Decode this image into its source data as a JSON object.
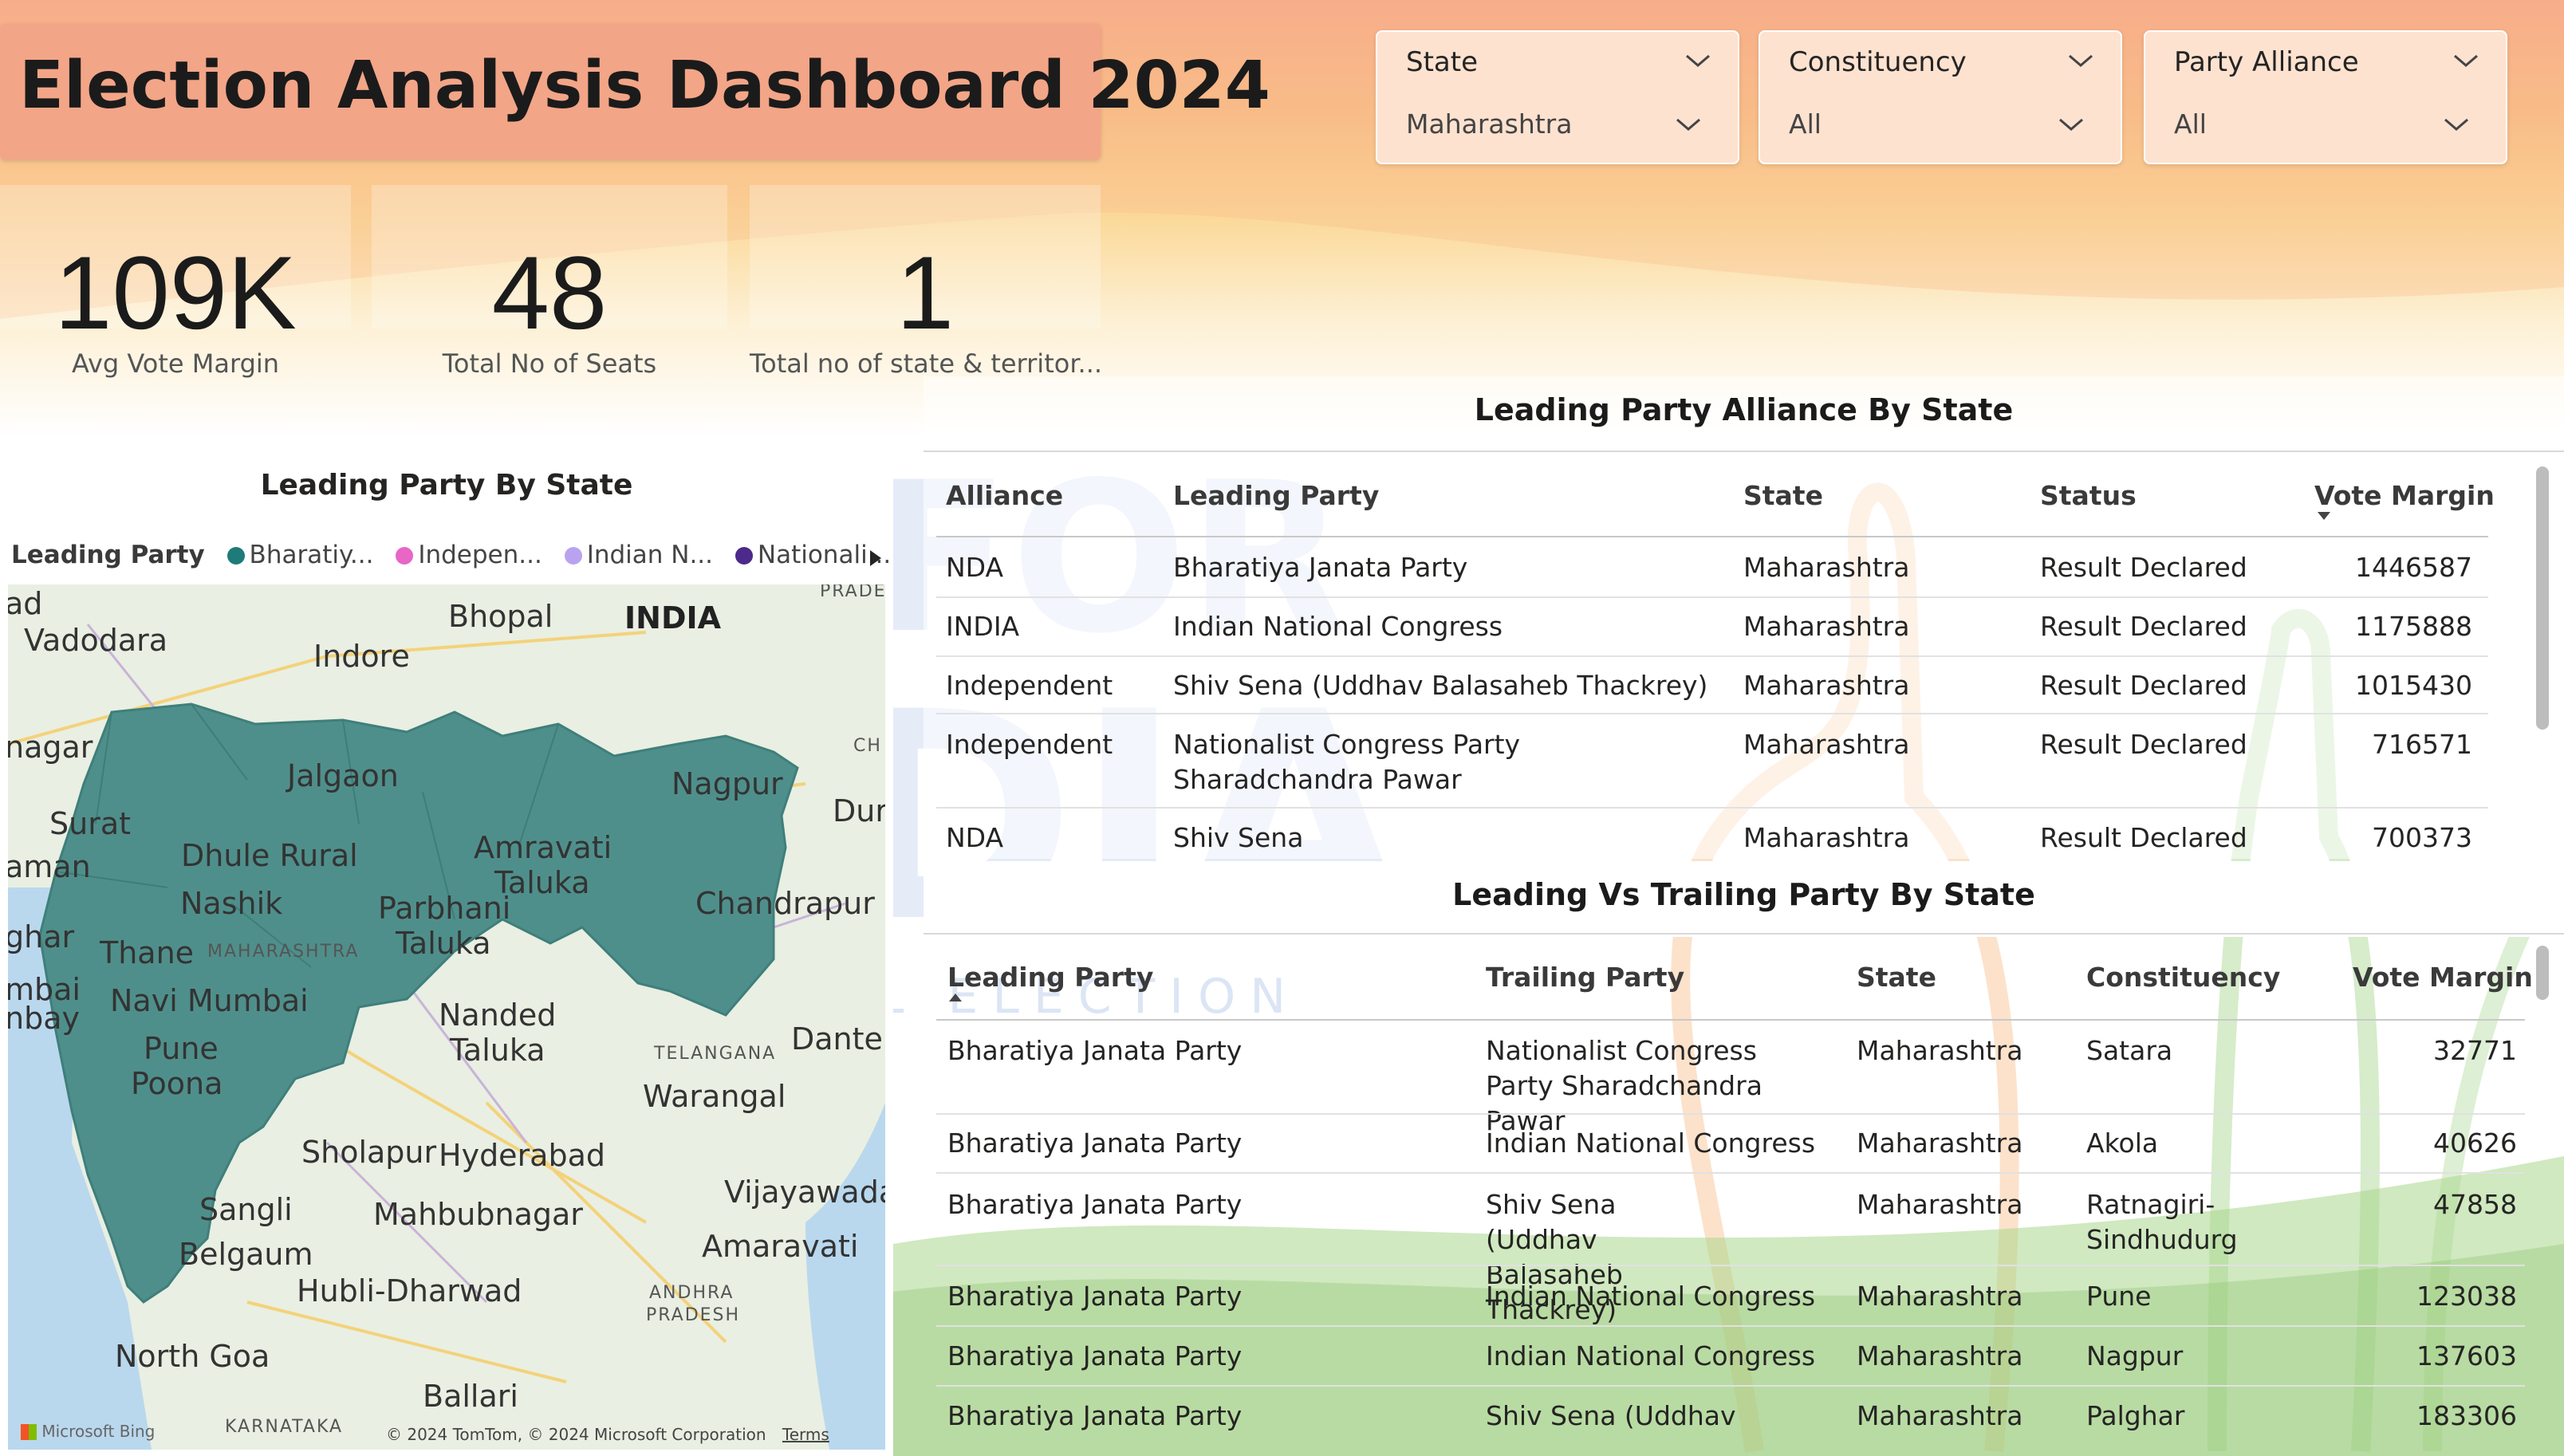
{
  "title": "Election Analysis Dashboard 2024",
  "slicers": [
    {
      "title": "State",
      "value": "Maharashtra"
    },
    {
      "title": "Constituency",
      "value": "All"
    },
    {
      "title": "Party Alliance",
      "value": "All"
    }
  ],
  "kpis": [
    {
      "value": "109K",
      "label": "Avg Vote Margin"
    },
    {
      "value": "48",
      "label": "Total No of Seats"
    },
    {
      "value": "1",
      "label": "Total no of state & territor..."
    }
  ],
  "map": {
    "title": "Leading Party By State",
    "legend_title": "Leading Party",
    "legend_items": [
      {
        "label": "Bharatiy...",
        "color": "#1f7a7a"
      },
      {
        "label": "Indepen...",
        "color": "#e866c5"
      },
      {
        "label": "Indian N...",
        "color": "#b9a3f0"
      },
      {
        "label": "Nationali...",
        "color": "#4b2a8a"
      }
    ],
    "fill_color": "#4f8f8b",
    "cities": [
      {
        "name": "Vadodara"
      },
      {
        "name": "Bhopal"
      },
      {
        "name": "INDIA"
      },
      {
        "name": "Indore"
      },
      {
        "name": "Jalgaon"
      },
      {
        "name": "Nagpur"
      },
      {
        "name": "Surat"
      },
      {
        "name": "Dhule Rural"
      },
      {
        "name": "Amravati"
      },
      {
        "name": "Taluka"
      },
      {
        "name": "Nashik"
      },
      {
        "name": "Parbhani"
      },
      {
        "name": "Taluka"
      },
      {
        "name": "Chandrapur"
      },
      {
        "name": "Thane"
      },
      {
        "name": "MAHARASHTRA"
      },
      {
        "name": "Navi Mumbai"
      },
      {
        "name": "Nanded"
      },
      {
        "name": "Taluka"
      },
      {
        "name": "Pune"
      },
      {
        "name": "Poona"
      },
      {
        "name": "TELANGANA"
      },
      {
        "name": "Warangal"
      },
      {
        "name": "Sholapur"
      },
      {
        "name": "Hyderabad"
      },
      {
        "name": "Vijayawada"
      },
      {
        "name": "Sangli"
      },
      {
        "name": "Mahbubnagar"
      },
      {
        "name": "Belgaum"
      },
      {
        "name": "Amaravati"
      },
      {
        "name": "Hubli-Dharwad"
      },
      {
        "name": "ANDHRA"
      },
      {
        "name": "PRADESH"
      },
      {
        "name": "North Goa"
      },
      {
        "name": "Ballari"
      },
      {
        "name": "KARNATAKA"
      },
      {
        "name": "Dante"
      },
      {
        "name": "Dur"
      },
      {
        "name": "CH"
      },
      {
        "name": "PRADE"
      },
      {
        "name": "nagar"
      },
      {
        "name": "aman"
      },
      {
        "name": "ghar"
      },
      {
        "name": "mbai"
      },
      {
        "name": "nbay"
      },
      {
        "name": "ad"
      }
    ],
    "attribution": "© 2024 TomTom, © 2024 Microsoft Corporation",
    "terms": "Terms",
    "bing": "Microsoft Bing"
  },
  "alliance_table": {
    "title": "Leading Party Alliance By State",
    "columns": [
      "Alliance",
      "Leading Party",
      "State",
      "Status",
      "Vote Margin"
    ],
    "rows": [
      [
        "NDA",
        "Bharatiya Janata Party",
        "Maharashtra",
        "Result Declared",
        "1446587"
      ],
      [
        "INDIA",
        "Indian National Congress",
        "Maharashtra",
        "Result Declared",
        "1175888"
      ],
      [
        "Independent",
        "Shiv Sena (Uddhav Balasaheb Thackrey)",
        "Maharashtra",
        "Result Declared",
        "1015430"
      ],
      [
        "Independent",
        "Nationalist Congress Party Sharadchandra Pawar",
        "Maharashtra",
        "Result Declared",
        "716571"
      ],
      [
        "NDA",
        "Shiv Sena",
        "Maharashtra",
        "Result Declared",
        "700373"
      ]
    ]
  },
  "trailing_table": {
    "title": "Leading Vs Trailing Party By State",
    "columns": [
      "Leading Party",
      "Trailing Party",
      "State",
      "Constituency",
      "Vote Margin"
    ],
    "rows": [
      [
        "Bharatiya Janata Party",
        "Nationalist Congress Party Sharadchandra Pawar",
        "Maharashtra",
        "Satara",
        "32771"
      ],
      [
        "Bharatiya Janata Party",
        "Indian National Congress",
        "Maharashtra",
        "Akola",
        "40626"
      ],
      [
        "Bharatiya Janata Party",
        "Shiv Sena (Uddhav Balasaheb Thackrey)",
        "Maharashtra",
        "Ratnagiri-Sindhudurg",
        "47858"
      ],
      [
        "Bharatiya Janata Party",
        "Indian National Congress",
        "Maharashtra",
        "Pune",
        "123038"
      ],
      [
        "Bharatiya Janata Party",
        "Indian National Congress",
        "Maharashtra",
        "Nagpur",
        "137603"
      ],
      [
        "Bharatiya Janata Party",
        "Shiv Sena (Uddhav",
        "Maharashtra",
        "Palghar",
        "183306"
      ]
    ]
  },
  "colors": {
    "title_bg": "#f3a587",
    "slicer_bg": "#fde2d0",
    "map_fill": "#4f8f8b"
  }
}
